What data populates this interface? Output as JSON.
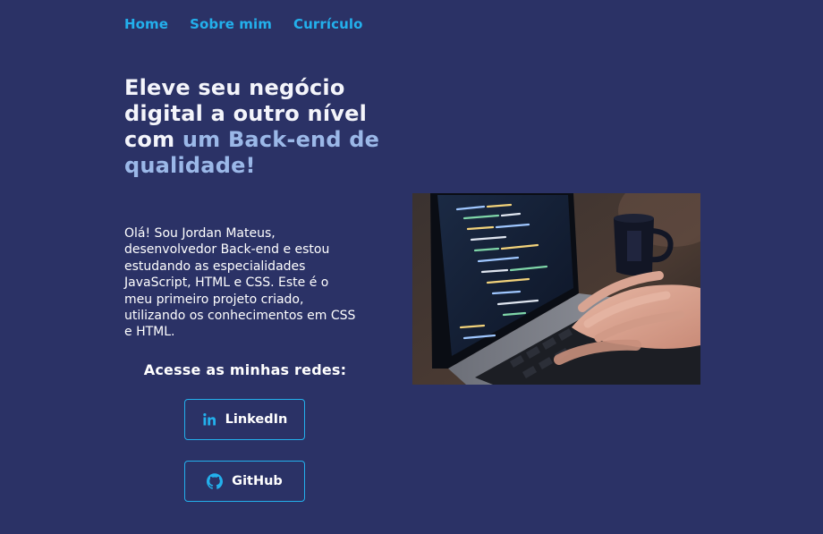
{
  "nav": {
    "items": [
      {
        "label": "Home"
      },
      {
        "label": "Sobre mim"
      },
      {
        "label": "Currículo"
      }
    ]
  },
  "hero": {
    "title_part1": "Eleve seu negócio digital a outro nível com ",
    "title_accent": "um Back-end de qualidade!",
    "intro": "Olá! Sou Jordan Mateus, desenvolvedor Back-end e estou estudando as especialidades JavaScript, HTML e CSS. Este é o meu primeiro projeto criado, utilizando os conhecimentos em CSS e HTML."
  },
  "social": {
    "heading": "Acesse as minhas redes:",
    "linkedin_label": "LinkedIn",
    "linkedin_icon": "linkedin-icon",
    "github_label": "GitHub",
    "github_icon": "github-icon"
  },
  "image": {
    "icon": "laptop-coding-photo"
  },
  "colors": {
    "background": "#2b3266",
    "accent": "#23b0ec",
    "title_highlight": "#9bb8e8"
  }
}
